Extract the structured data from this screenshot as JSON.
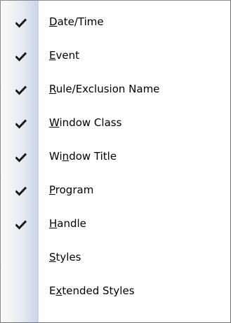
{
  "menu": {
    "items": [
      {
        "label": "Date/Time",
        "mnemonic_index": 0,
        "checked": true
      },
      {
        "label": "Event",
        "mnemonic_index": 0,
        "checked": true
      },
      {
        "label": "Rule/Exclusion Name",
        "mnemonic_index": 0,
        "checked": true
      },
      {
        "label": "Window Class",
        "mnemonic_index": 0,
        "checked": true
      },
      {
        "label": "Window Title",
        "mnemonic_index": 2,
        "checked": true
      },
      {
        "label": "Program",
        "mnemonic_index": 0,
        "checked": true
      },
      {
        "label": "Handle",
        "mnemonic_index": 0,
        "checked": true
      },
      {
        "label": "Styles",
        "mnemonic_index": 0,
        "checked": false
      },
      {
        "label": "Extended Styles",
        "mnemonic_index": 1,
        "checked": false
      }
    ],
    "check_icon": "checkmark-icon",
    "colors": {
      "gutter_light": "#fbfaf6",
      "gutter_dark": "#c9d4e5",
      "border": "#8a8a8a",
      "text": "#000000"
    }
  }
}
